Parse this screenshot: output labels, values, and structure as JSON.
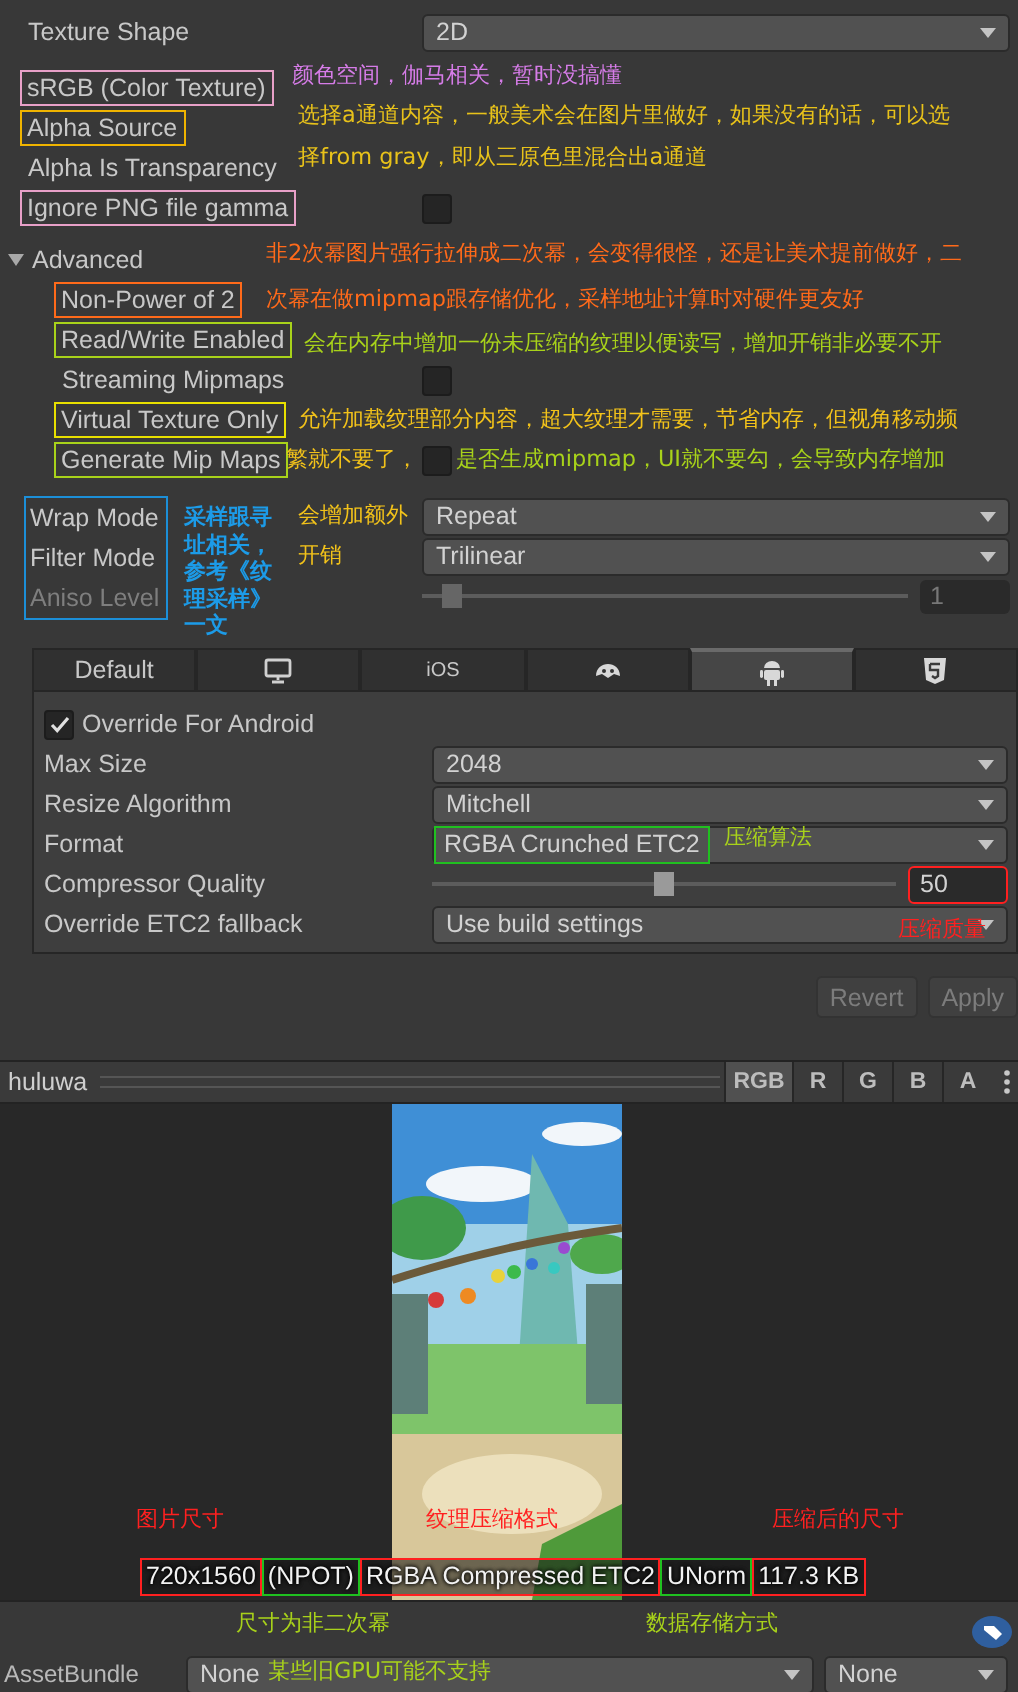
{
  "inspector": {
    "rows": [
      {
        "kind": "dropdown",
        "label": "Texture Shape",
        "value": "2D"
      },
      {
        "kind": "label",
        "label": "sRGB (Color Texture)",
        "color": "#e8a0c8"
      },
      {
        "kind": "label",
        "label": "Alpha Source",
        "color": "#f0b400"
      },
      {
        "kind": "label",
        "label": "Alpha Is Transparency"
      },
      {
        "kind": "checkbox",
        "label": "Ignore PNG file gamma",
        "checked": false,
        "color": "#e8a0c8"
      },
      {
        "kind": "foldout",
        "label": "Advanced",
        "expanded": true,
        "children": [
          {
            "kind": "label",
            "label": "Non-Power of 2",
            "color": "#ff6a1a"
          },
          {
            "kind": "label",
            "label": "Read/Write Enabled",
            "color": "#a8d21a"
          },
          {
            "kind": "checkbox",
            "label": "Streaming Mipmaps",
            "checked": false
          },
          {
            "kind": "label",
            "label": "Virtual Texture Only",
            "color": "#e8e000"
          },
          {
            "kind": "checkbox",
            "label": "Generate Mip Maps",
            "checked": false,
            "color": "#a8d21a"
          }
        ]
      },
      {
        "kind": "group",
        "color": "#1c8fd8",
        "children": [
          {
            "kind": "dropdown",
            "label": "Wrap Mode",
            "value": "Repeat"
          },
          {
            "kind": "dropdown",
            "label": "Filter Mode",
            "value": "Trilinear"
          },
          {
            "kind": "slider",
            "label": "Aniso Level",
            "level": 0.06,
            "value": "1",
            "disabled": true
          }
        ]
      }
    ]
  },
  "platform_tabs": [
    {
      "kind": "text",
      "label": "Default",
      "selected": false
    },
    {
      "kind": "monitor",
      "selected": false
    },
    {
      "kind": "text",
      "label": "iOS",
      "selected": false
    },
    {
      "kind": "creature",
      "selected": false
    },
    {
      "kind": "android",
      "selected": true
    },
    {
      "kind": "shield",
      "selected": false
    }
  ],
  "platform": {
    "override": {
      "label": "Override For Android",
      "checked": true
    },
    "rows": [
      {
        "kind": "dropdown",
        "label": "Max Size",
        "value": "2048"
      },
      {
        "kind": "dropdown",
        "label": "Resize Algorithm",
        "value": "Mitchell"
      },
      {
        "kind": "dropdown",
        "label": "Format",
        "value": "RGBA Crunched ETC2",
        "color": "#20c020"
      },
      {
        "kind": "slider",
        "label": "Compressor Quality",
        "level": 0.5,
        "value": "50",
        "disabled": false,
        "color": "#ff2020"
      },
      {
        "kind": "dropdown",
        "label": "Override ETC2 fallback",
        "value": "Use build settings"
      }
    ]
  },
  "buttons": [
    {
      "label": "Revert",
      "disabled": true
    },
    {
      "label": "Apply",
      "disabled": true
    }
  ],
  "preview": {
    "title": "huluwa",
    "channels": [
      {
        "label": "RGB",
        "selected": true
      },
      {
        "label": "R",
        "selected": false
      },
      {
        "label": "G",
        "selected": false
      },
      {
        "label": "B",
        "selected": false
      },
      {
        "label": "A",
        "selected": false
      }
    ],
    "info": [
      {
        "text": "720x1560",
        "color": "#ff2020"
      },
      {
        "text": "(NPOT)",
        "color": "#20c020"
      },
      {
        "text": "RGBA Compressed ETC2",
        "color": "#ff2020"
      },
      {
        "text": "UNorm",
        "color": "#20c020"
      },
      {
        "text": "117.3 KB",
        "color": "#ff2020"
      }
    ]
  },
  "asset_bundle": {
    "label": "AssetBundle",
    "bundle": "None",
    "variant": "None"
  },
  "annotations": [
    {
      "text": "颜色空间，伽马相关，暂时没搞懂",
      "color": "#d67ce8"
    },
    {
      "text": "选择a通道内容，一般美术会在图片里做好，如果没有的话，可以选",
      "color": "#e8c21a"
    },
    {
      "text": "择from gray，即从三原色里混合出a通道",
      "color": "#e8c21a"
    },
    {
      "text": "非2次幂图片强行拉伸成二次幂，会变得很怪，还是让美术提前做好，二",
      "color": "#ff6a1a"
    },
    {
      "text": "次幂在做mipmap跟存储优化，采样地址计算时对硬件更友好",
      "color": "#ff6a1a"
    },
    {
      "text": "会在内存中增加一份未压缩的纹理以便读写，增加开销非必要不开",
      "color": "#a8d21a"
    },
    {
      "text": "允许加载纹理部分内容，超大纹理才需要，节省内存，但视角移动频",
      "color": "#f2c21a"
    },
    {
      "text": "繁就不要了，",
      "color": "#f2c21a"
    },
    {
      "text": "是否生成mipmap，UI就不要勾，会导致内存增加",
      "color": "#a8d21a"
    },
    {
      "text": "会增加额外",
      "color": "#f2c21a"
    },
    {
      "text": "开销",
      "color": "#f2c21a"
    },
    {
      "text": "采样跟寻址相关，参考《纹理采样》一文",
      "color": "#1c9be8"
    },
    {
      "text": "压缩算法",
      "color": "#a8d21a"
    },
    {
      "text": "压缩质量",
      "color": "#ff2020"
    },
    {
      "text": "图片尺寸",
      "color": "#ff2020"
    },
    {
      "text": "纹理压缩格式",
      "color": "#ff2020"
    },
    {
      "text": "压缩后的尺寸",
      "color": "#ff2020"
    },
    {
      "text": "尺寸为非二次幂",
      "color": "#a8d21a"
    },
    {
      "text": "数据存储方式",
      "color": "#a8d21a"
    },
    {
      "text": "某些旧GPU可能不支持",
      "color": "#a8d21a"
    }
  ]
}
